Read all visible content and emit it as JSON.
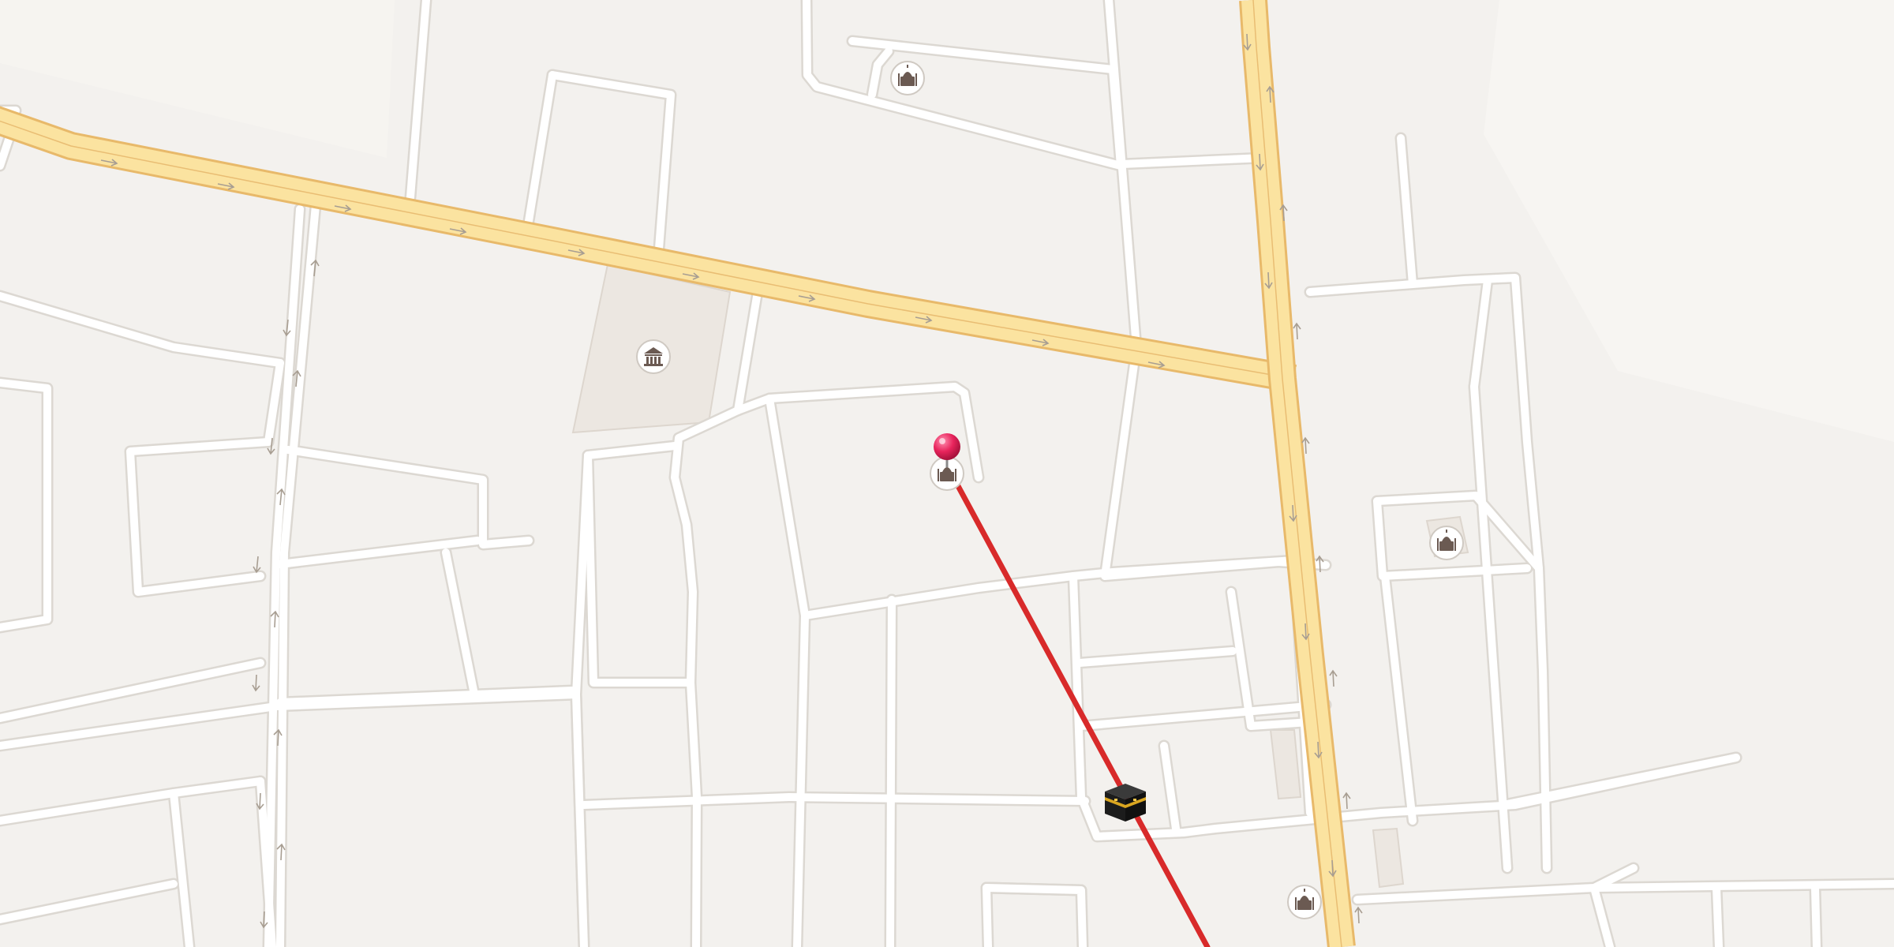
{
  "map": {
    "type": "street-map",
    "colors": {
      "background": "#f3f1ee",
      "block_fill": "#f6f4f1",
      "minor_road": "#ffffff",
      "minor_road_edge": "#dcd8d2",
      "major_road": "#fbe3a0",
      "major_road_edge": "#e8b96a",
      "route_line": "#d82a2a",
      "pin": "#e8245c",
      "poi_icon": "#6b5a52"
    },
    "pois": [
      {
        "name": "mosque",
        "icon": "mosque-icon"
      },
      {
        "name": "museum",
        "icon": "museum-icon"
      },
      {
        "name": "mosque",
        "icon": "mosque-icon"
      },
      {
        "name": "mosque",
        "icon": "mosque-icon"
      },
      {
        "name": "mosque",
        "icon": "mosque-icon"
      }
    ],
    "markers": {
      "selected_pin": {
        "icon": "map-pin-icon"
      },
      "kaaba": {
        "icon": "kaaba-icon"
      }
    },
    "route": {
      "icon": "route-line"
    }
  }
}
